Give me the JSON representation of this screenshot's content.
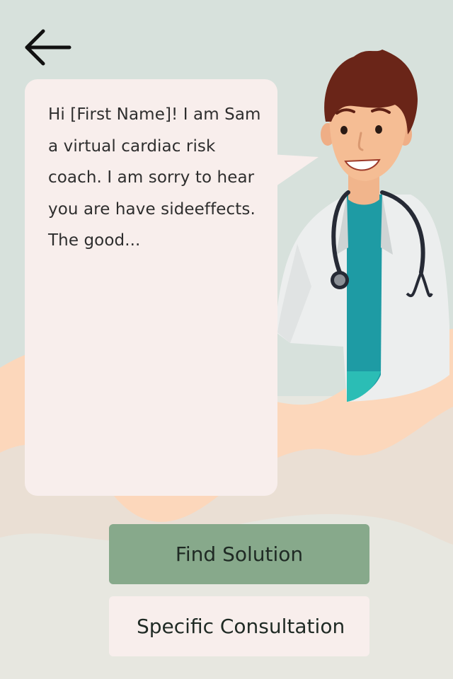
{
  "navigation": {
    "back_icon": "arrow-left-icon"
  },
  "coach": {
    "message": "Hi [First Name]! I am Sam a virtual cardiac risk coach. I am sorry to hear you are have sideeffects. The good..."
  },
  "actions": {
    "find_solution_label": "Find Solution",
    "specific_consultation_label": "Specific Consultation"
  },
  "colors": {
    "background": "#e7e7e0",
    "top_background": "#d7e1dc",
    "wave_peach": "#fcd7bb",
    "bubble": "#f8eeec",
    "primary_button": "#87a98b"
  }
}
